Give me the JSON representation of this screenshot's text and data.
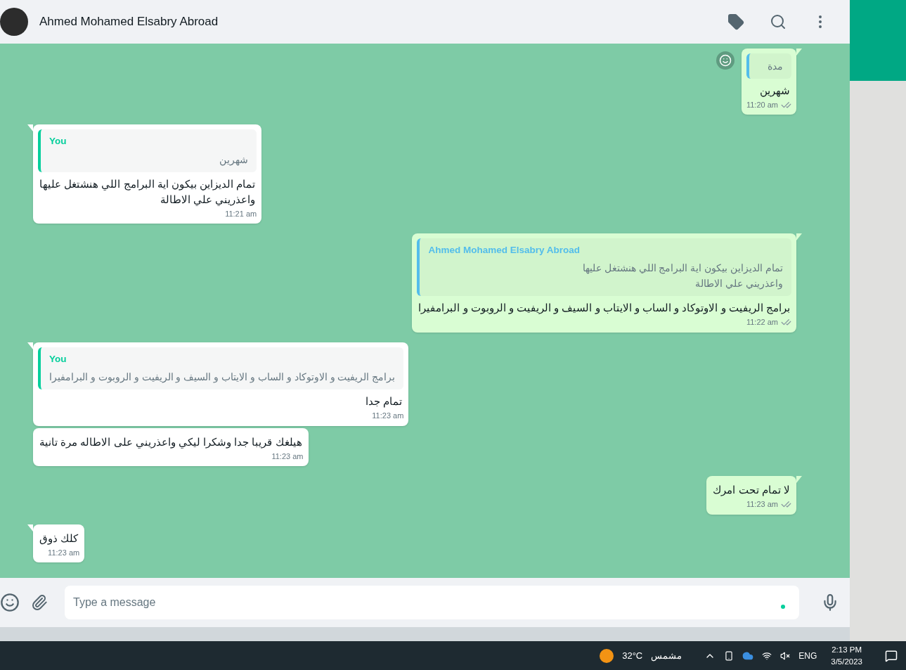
{
  "header": {
    "contact_name": "Ahmed Mohamed Elsabry Abroad"
  },
  "messages": [
    {
      "kind": "outgoing",
      "continued": false,
      "reaction_button": true,
      "quote": {
        "text": "مدة"
      },
      "text": "شهرين",
      "time": "11:20 am",
      "read": false
    },
    {
      "kind": "incoming",
      "continued": false,
      "quote": {
        "author": "You",
        "text": "شهرين"
      },
      "text": "تمام الديزاين بيكون اية البرامج اللي هنشتغل عليها\nواعذريني علي الاطالة",
      "time": "11:21 am"
    },
    {
      "kind": "outgoing",
      "continued": false,
      "quote": {
        "author": "Ahmed Mohamed Elsabry Abroad",
        "text": "تمام الديزاين بيكون اية البرامج اللي هنشتغل عليها\nواعذريني علي الاطالة"
      },
      "text": "برامج الريفيت و الاوتوكاد و الساب و الايتاب و السيف و الريفيت و الروبوت و البرامفيرا",
      "time": "11:22 am",
      "read": false
    },
    {
      "kind": "incoming",
      "continued": false,
      "quote": {
        "author": "You",
        "text": "برامج الريفيت و الاوتوكاد و الساب و الايتاب و السيف و الريفيت و الروبوت و البرامفيرا"
      },
      "text": "تمام جدا",
      "time": "11:23 am"
    },
    {
      "kind": "incoming",
      "continued": true,
      "text": "هيلغك قريبا جدا وشكرا ليكي واعذريني على الاطاله مرة تانية",
      "time": "11:23 am"
    },
    {
      "kind": "outgoing",
      "continued": false,
      "text": "لا تمام تحت امرك",
      "time": "11:23 am",
      "read": false
    },
    {
      "kind": "incoming",
      "continued": false,
      "text": "كلك ذوق",
      "time": "11:23 am"
    }
  ],
  "composer": {
    "placeholder": "Type a message"
  },
  "taskbar": {
    "temperature": "32°C",
    "weather": "مشمس",
    "language": "ENG",
    "time": "2:13 PM",
    "date": "3/5/2023"
  }
}
